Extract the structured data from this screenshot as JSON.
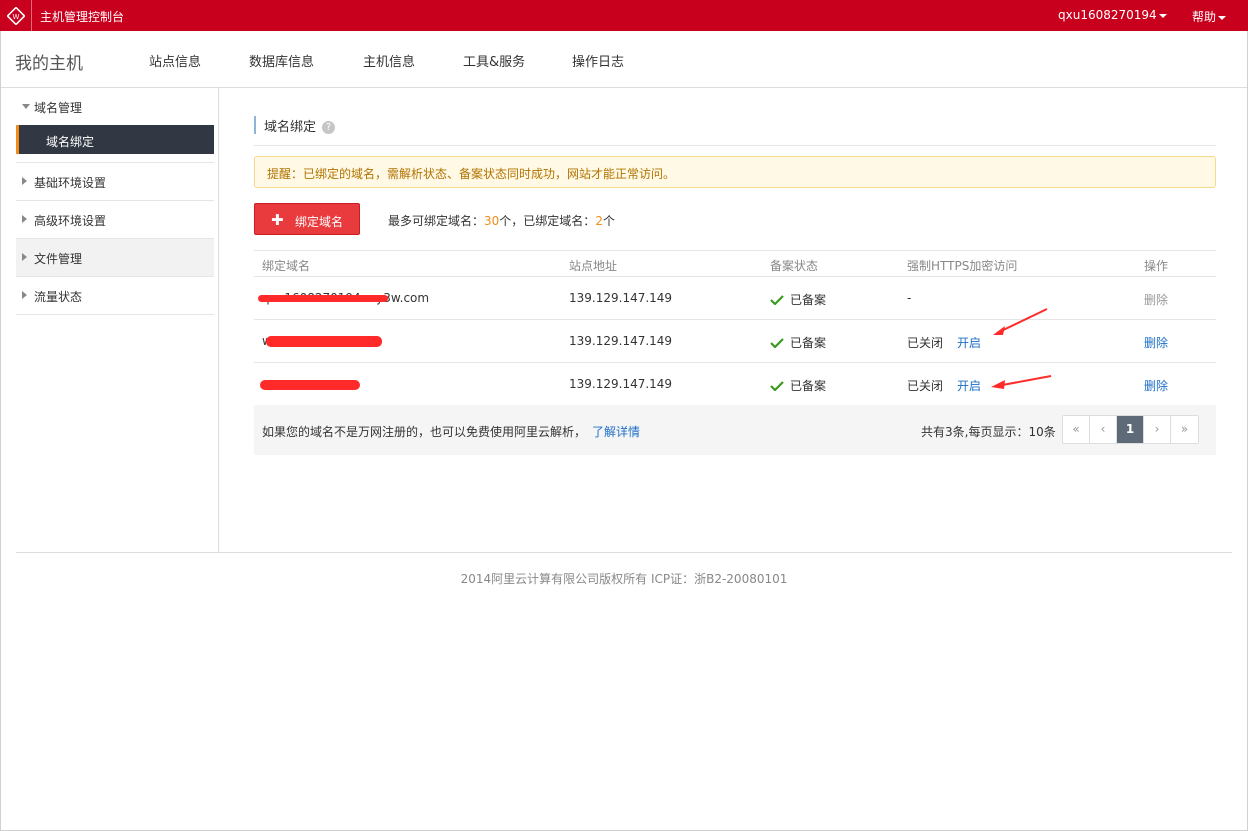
{
  "topbar": {
    "title": "主机管理控制台",
    "user": "qxu1608270194",
    "help": "帮助"
  },
  "navbar": {
    "brand": "我的主机",
    "items": [
      "站点信息",
      "数据库信息",
      "主机信息",
      "工具&服务",
      "操作日志"
    ]
  },
  "sidebar": {
    "domain_group": "域名管理",
    "domain_binding": "域名绑定",
    "basic_env": "基础环境设置",
    "advanced_env": "高级环境设置",
    "file_mgmt": "文件管理",
    "traffic": "流量状态"
  },
  "main": {
    "title": "域名绑定",
    "help_mark": "?",
    "notice": "提醒：已绑定的域名，需解析状态、备案状态同时成功，网站才能正常访问。",
    "add_button": "绑定域名",
    "limit_prefix": "最多可绑定域名：",
    "limit_max": "30",
    "limit_mid": "个，已绑定域名：",
    "limit_bound": "2",
    "limit_suffix": "个"
  },
  "table": {
    "headers": {
      "domain": "绑定域名",
      "ip": "站点地址",
      "beian": "备案状态",
      "https": "强制HTTPS加密访问",
      "op": "操作"
    },
    "rows": [
      {
        "domain": "qxu1608270194.my3w.com",
        "ip": "139.129.147.149",
        "beian": "已备案",
        "https_status": "-",
        "https_action": "",
        "op": "删除"
      },
      {
        "domain": "w",
        "ip": "139.129.147.149",
        "beian": "已备案",
        "https_status": "已关闭",
        "https_action": "开启",
        "op": "删除"
      },
      {
        "domain": "",
        "ip": "139.129.147.149",
        "beian": "已备案",
        "https_status": "已关闭",
        "https_action": "开启",
        "op": "删除"
      }
    ]
  },
  "footer_row": {
    "tip": "如果您的域名不是万网注册的，也可以免费使用阿里云解析，",
    "tip_link": "了解详情",
    "total": "共有3条,每页显示：10条",
    "pager": [
      "«",
      "‹",
      "1",
      "›",
      "»"
    ]
  },
  "copyright": "2014阿里云计算有限公司版权所有 ICP证：浙B2-20080101",
  "colors": {
    "topbar": "#c9001d",
    "accent_button": "#e93a3d",
    "link": "#1e6fc8",
    "check": "#3a9a1f",
    "active_page": "#5f6a78"
  }
}
